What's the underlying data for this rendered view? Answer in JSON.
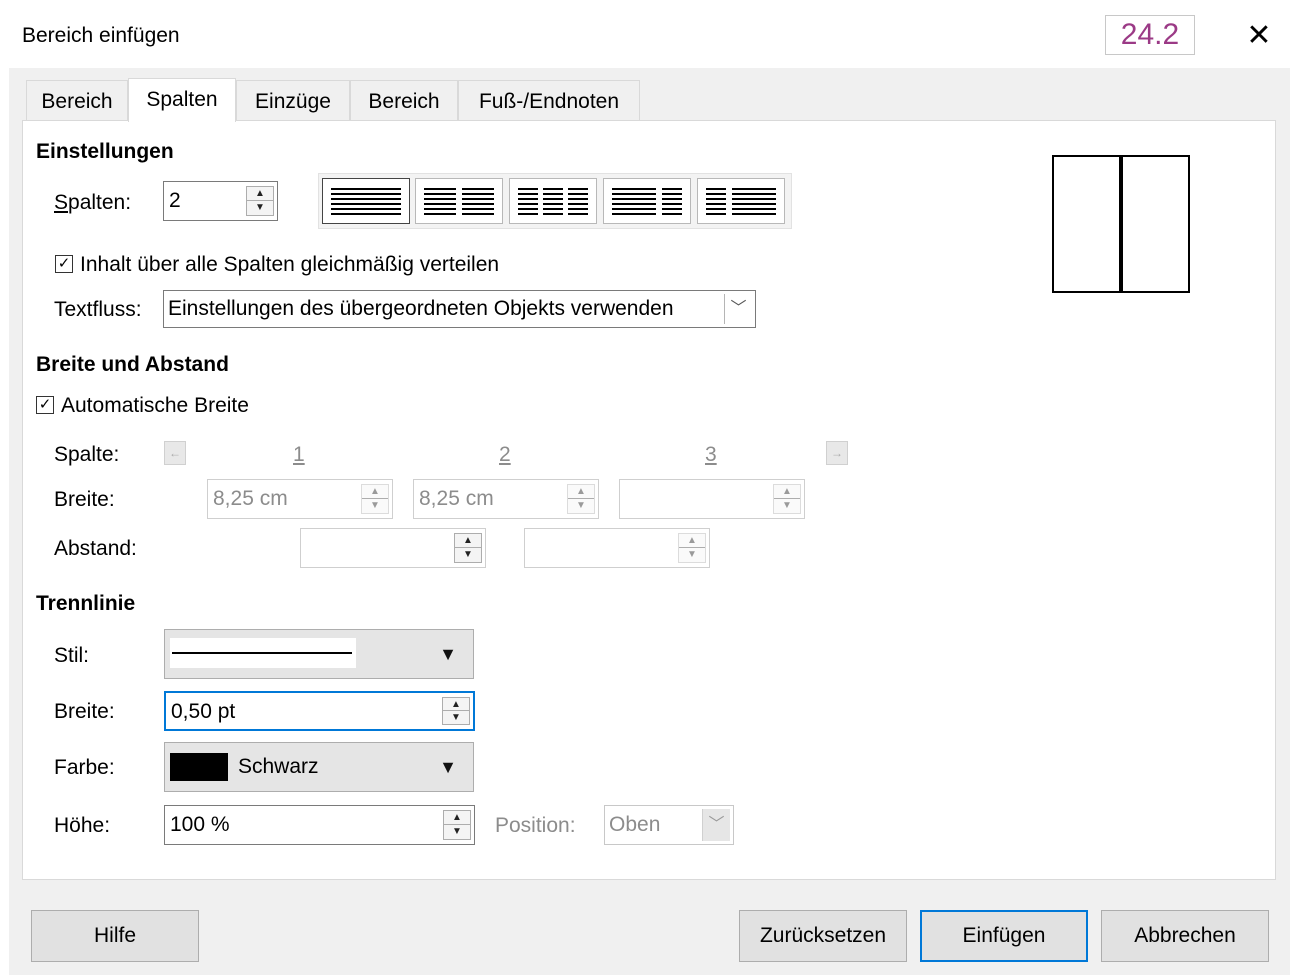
{
  "window": {
    "title": "Bereich einfügen",
    "badge": "24.2",
    "close_icon": "✕"
  },
  "tabs": [
    {
      "label": "Bereich",
      "active": false
    },
    {
      "label": "Spalten",
      "active": true
    },
    {
      "label": "Einzüge",
      "active": false
    },
    {
      "label": "Bereich",
      "active": false
    },
    {
      "label": "Fuß-/Endnoten",
      "active": false
    }
  ],
  "settings": {
    "heading": "Einstellungen",
    "columns_label": "Spalten:",
    "columns_value": "2",
    "distribute_label": "Inhalt über alle Spalten gleichmäßig verteilen",
    "distribute_checked": true,
    "textflow_label": "Textfluss:",
    "textflow_value": "Einstellungen des übergeordneten Objekts verwenden"
  },
  "width_spacing": {
    "heading": "Breite und Abstand",
    "auto_width_label": "Automatische Breite",
    "auto_width_checked": true,
    "column_label": "Spalte:",
    "col_numbers": [
      "1",
      "2",
      "3"
    ],
    "width_label": "Breite:",
    "widths": [
      "8,25 cm",
      "8,25 cm",
      ""
    ],
    "spacing_label": "Abstand:",
    "spacings": [
      "",
      ""
    ]
  },
  "separator": {
    "heading": "Trennlinie",
    "style_label": "Stil:",
    "width_label": "Breite:",
    "width_value": "0,50 pt",
    "color_label": "Farbe:",
    "color_name": "Schwarz",
    "color_hex": "#000000",
    "height_label": "Höhe:",
    "height_value": "100 %",
    "position_label": "Position:",
    "position_value": "Oben"
  },
  "buttons": {
    "help": "Hilfe",
    "reset": "Zurücksetzen",
    "insert": "Einfügen",
    "cancel": "Abbrechen"
  }
}
